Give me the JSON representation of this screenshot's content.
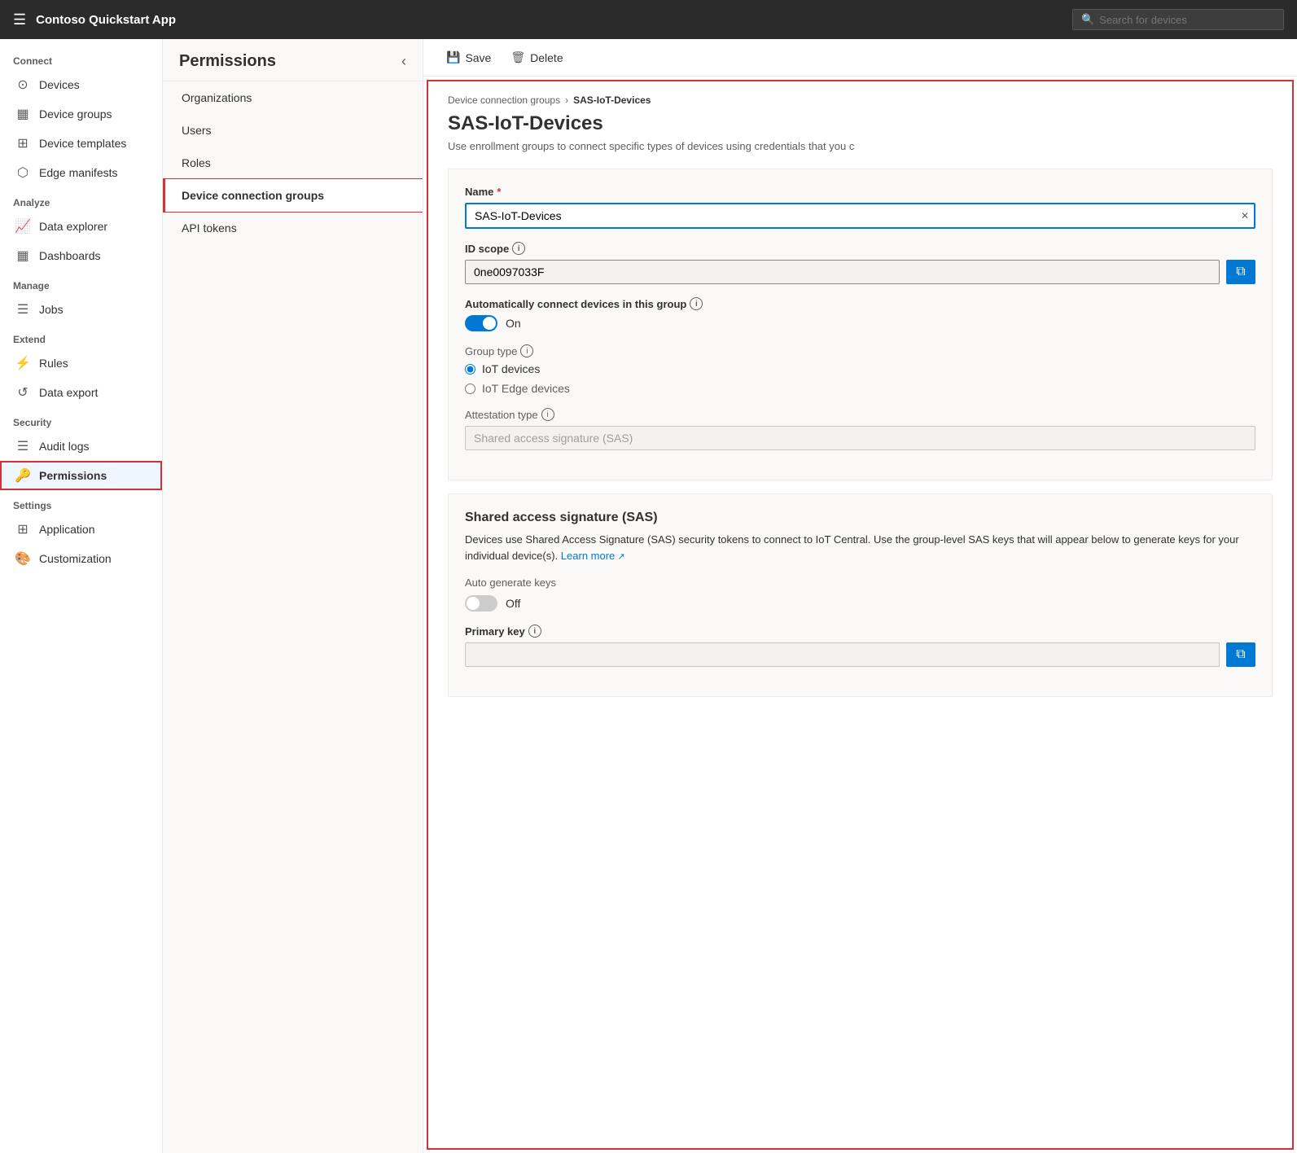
{
  "topbar": {
    "title": "Contoso Quickstart App",
    "search_placeholder": "Search for devices"
  },
  "sidebar": {
    "sections": [
      {
        "label": "Connect",
        "items": [
          {
            "id": "devices",
            "label": "Devices",
            "icon": "⊙"
          },
          {
            "id": "device-groups",
            "label": "Device groups",
            "icon": "▦"
          },
          {
            "id": "device-templates",
            "label": "Device templates",
            "icon": "⊞"
          },
          {
            "id": "edge-manifests",
            "label": "Edge manifests",
            "icon": "⬡"
          }
        ]
      },
      {
        "label": "Analyze",
        "items": [
          {
            "id": "data-explorer",
            "label": "Data explorer",
            "icon": "📈"
          },
          {
            "id": "dashboards",
            "label": "Dashboards",
            "icon": "▦"
          }
        ]
      },
      {
        "label": "Manage",
        "items": [
          {
            "id": "jobs",
            "label": "Jobs",
            "icon": "☰"
          }
        ]
      },
      {
        "label": "Extend",
        "items": [
          {
            "id": "rules",
            "label": "Rules",
            "icon": "⚡"
          },
          {
            "id": "data-export",
            "label": "Data export",
            "icon": "↺"
          }
        ]
      },
      {
        "label": "Security",
        "items": [
          {
            "id": "audit-logs",
            "label": "Audit logs",
            "icon": "☰"
          },
          {
            "id": "permissions",
            "label": "Permissions",
            "icon": "🔑",
            "active": true
          }
        ]
      },
      {
        "label": "Settings",
        "items": [
          {
            "id": "application",
            "label": "Application",
            "icon": "⊞"
          },
          {
            "id": "customization",
            "label": "Customization",
            "icon": "🎨"
          }
        ]
      }
    ]
  },
  "permissions_panel": {
    "title": "Permissions",
    "nav_items": [
      {
        "id": "organizations",
        "label": "Organizations"
      },
      {
        "id": "users",
        "label": "Users"
      },
      {
        "id": "roles",
        "label": "Roles"
      },
      {
        "id": "device-connection-groups",
        "label": "Device connection groups",
        "active": true
      },
      {
        "id": "api-tokens",
        "label": "API tokens"
      }
    ]
  },
  "toolbar": {
    "save_label": "Save",
    "delete_label": "Delete"
  },
  "main": {
    "breadcrumb_parent": "Device connection groups",
    "breadcrumb_current": "SAS-IoT-Devices",
    "title": "SAS-IoT-Devices",
    "description": "Use enrollment groups to connect specific types of devices using credentials that you c",
    "form": {
      "name_label": "Name",
      "name_value": "SAS-IoT-Devices",
      "id_scope_label": "ID scope",
      "id_scope_value": "0ne0097033F",
      "auto_connect_label": "Automatically connect devices in this group",
      "auto_connect_toggle_label": "On",
      "auto_connect_on": true,
      "group_type_label": "Group type",
      "group_type_options": [
        {
          "id": "iot-devices",
          "label": "IoT devices",
          "selected": true
        },
        {
          "id": "iot-edge",
          "label": "IoT Edge devices",
          "selected": false
        }
      ],
      "attestation_type_label": "Attestation type",
      "attestation_type_value": "Shared access signature (SAS)"
    },
    "sas_section": {
      "title": "Shared access signature (SAS)",
      "description": "Devices use Shared Access Signature (SAS) security tokens to connect to IoT Central. Use the group-level SAS keys that will appear below to generate keys for your individual device(s).",
      "learn_more_label": "Learn more",
      "auto_generate_label": "Auto generate keys",
      "auto_generate_on": false,
      "auto_generate_toggle_label": "Off",
      "primary_key_label": "Primary key",
      "primary_key_value": ""
    }
  }
}
